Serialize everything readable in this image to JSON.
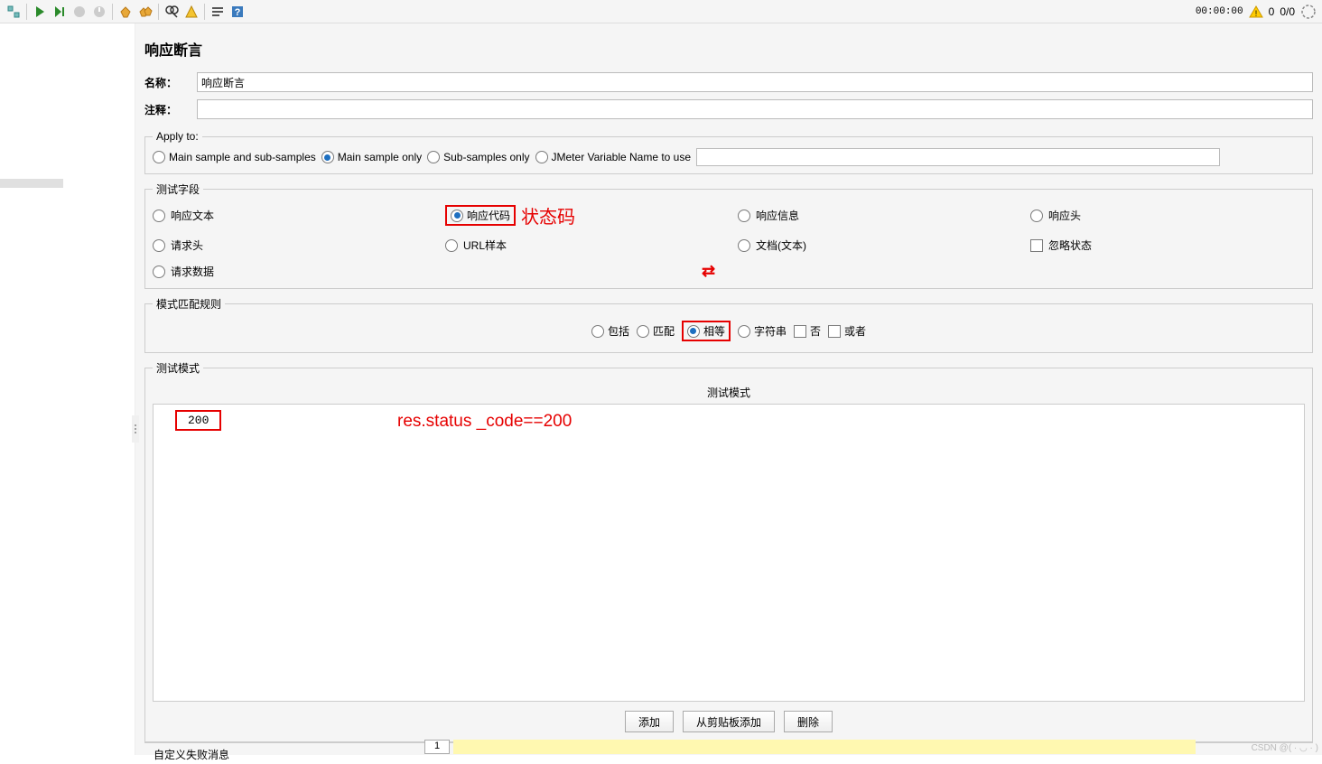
{
  "toolbar": {
    "timer": "00:00:00",
    "warn_count": "0",
    "thread_count": "0/0"
  },
  "panel": {
    "title": "响应断言",
    "name_label": "名称：",
    "name_value": "响应断言",
    "comment_label": "注释：",
    "comment_value": ""
  },
  "apply_to": {
    "legend": "Apply to:",
    "options": [
      {
        "label": "Main sample and sub-samples",
        "selected": false
      },
      {
        "label": "Main sample only",
        "selected": true
      },
      {
        "label": "Sub-samples only",
        "selected": false
      },
      {
        "label": "JMeter Variable Name to use",
        "selected": false
      }
    ]
  },
  "test_field": {
    "legend": "测试字段",
    "status_annotation": "状态码",
    "options": [
      {
        "label": "响应文本",
        "selected": false,
        "type": "radio"
      },
      {
        "label": "响应代码",
        "selected": true,
        "type": "radio",
        "highlighted": true
      },
      {
        "label": "响应信息",
        "selected": false,
        "type": "radio"
      },
      {
        "label": "响应头",
        "selected": false,
        "type": "radio"
      },
      {
        "label": "请求头",
        "selected": false,
        "type": "radio"
      },
      {
        "label": "URL样本",
        "selected": false,
        "type": "radio"
      },
      {
        "label": "文档(文本)",
        "selected": false,
        "type": "radio"
      },
      {
        "label": "忽略状态",
        "selected": false,
        "type": "checkbox"
      },
      {
        "label": "请求数据",
        "selected": false,
        "type": "radio"
      }
    ]
  },
  "match_rule": {
    "legend": "模式匹配规则",
    "options": [
      {
        "label": "包括",
        "selected": false,
        "type": "radio"
      },
      {
        "label": "匹配",
        "selected": false,
        "type": "radio"
      },
      {
        "label": "相等",
        "selected": true,
        "type": "radio",
        "highlighted": true
      },
      {
        "label": "字符串",
        "selected": false,
        "type": "radio"
      },
      {
        "label": "否",
        "selected": false,
        "type": "checkbox"
      },
      {
        "label": "或者",
        "selected": false,
        "type": "checkbox"
      }
    ]
  },
  "test_pattern": {
    "legend": "测试模式",
    "header": "测试模式",
    "value": "200",
    "annotation": "res.status _code==200"
  },
  "buttons": {
    "add": "添加",
    "paste": "从剪贴板添加",
    "delete": "删除"
  },
  "custom_fail": {
    "legend": "自定义失败消息"
  },
  "footer": {
    "page": "1",
    "watermark": "CSDN @( · ◡ · )"
  }
}
